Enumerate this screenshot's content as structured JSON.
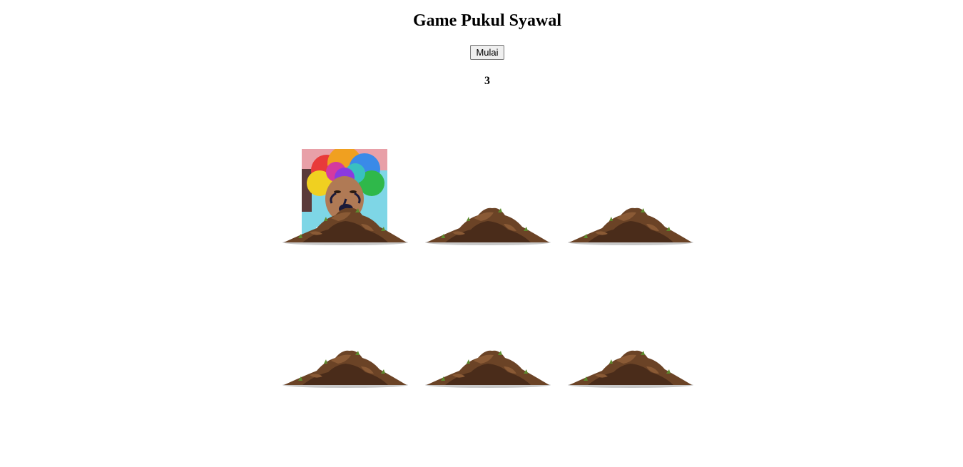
{
  "game": {
    "title": "Game Pukul Syawal",
    "start_label": "Mulai",
    "score": "3"
  },
  "board": {
    "holes": [
      {
        "id": 1,
        "mole_up": true
      },
      {
        "id": 2,
        "mole_up": false
      },
      {
        "id": 3,
        "mole_up": false
      },
      {
        "id": 4,
        "mole_up": false
      },
      {
        "id": 5,
        "mole_up": false
      },
      {
        "id": 6,
        "mole_up": false
      }
    ]
  },
  "icons": {
    "mole": "syawal-face-icon",
    "dirt": "dirt-mound-icon"
  },
  "colors": {
    "background": "#ffffff",
    "dirt_dark": "#4a2c1a",
    "dirt_mid": "#6b4326",
    "dirt_light": "#8a5a35",
    "grass": "#5e8b2e"
  }
}
